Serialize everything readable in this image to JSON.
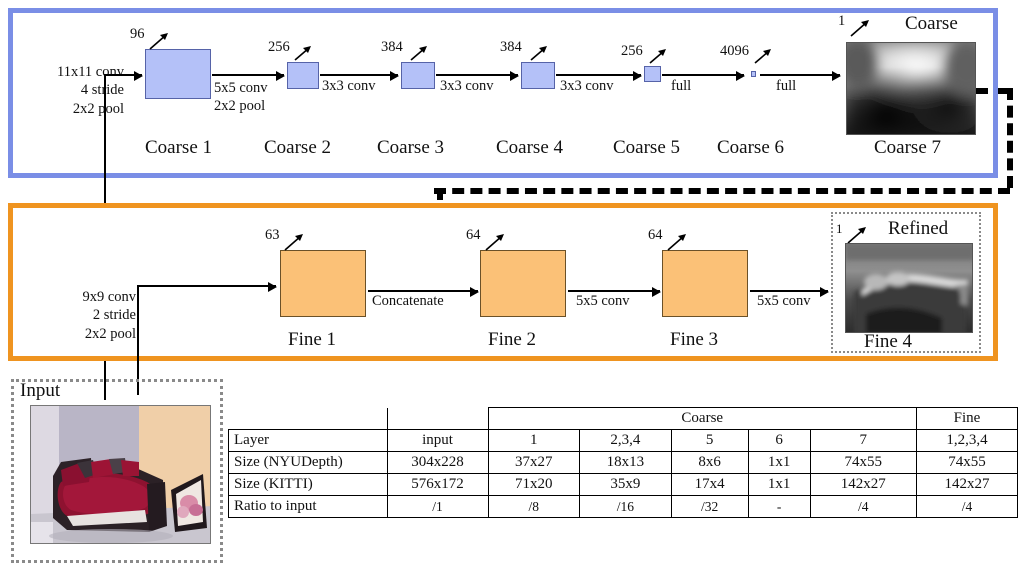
{
  "figure": {
    "type": "neural-network-architecture-diagram",
    "title": "Coarse and Fine depth prediction network"
  },
  "coarse": {
    "section_label": "Coarse",
    "input_op": "11x11 conv\n4 stride\n2x2 pool",
    "input_op_lines": [
      "11x11 conv",
      "4 stride",
      "2x2 pool"
    ],
    "stages": [
      {
        "name": "Coarse 1",
        "channels": "96",
        "next_op_lines": [
          "5x5 conv",
          "2x2 pool"
        ]
      },
      {
        "name": "Coarse 2",
        "channels": "256",
        "next_op_lines": [
          "3x3 conv"
        ]
      },
      {
        "name": "Coarse 3",
        "channels": "384",
        "next_op_lines": [
          "3x3 conv"
        ]
      },
      {
        "name": "Coarse 4",
        "channels": "384",
        "next_op_lines": [
          "3x3 conv"
        ]
      },
      {
        "name": "Coarse 5",
        "channels": "256",
        "next_op_lines": [
          "full"
        ]
      },
      {
        "name": "Coarse 6",
        "channels": "4096",
        "next_op_lines": [
          "full"
        ]
      },
      {
        "name": "Coarse 7",
        "channels": "1",
        "next_op_lines": []
      }
    ],
    "ops": {
      "op1_line1": "5x5 conv",
      "op1_line2": "2x2 pool",
      "op2": "3x3 conv",
      "op3": "3x3 conv",
      "op4": "3x3 conv",
      "op5": "full",
      "op6": "full"
    },
    "output_caption": "Coarse"
  },
  "fine": {
    "section_label": "Fine",
    "input_op_lines": [
      "9x9 conv",
      "2 stride",
      "2x2 pool"
    ],
    "stages": [
      {
        "name": "Fine 1",
        "channels": "63",
        "next_op_lines": [
          "Concatenate"
        ]
      },
      {
        "name": "Fine 2",
        "channels": "64",
        "next_op_lines": [
          "5x5 conv"
        ]
      },
      {
        "name": "Fine 3",
        "channels": "64",
        "next_op_lines": [
          "5x5 conv"
        ]
      },
      {
        "name": "Fine 4",
        "channels": "1",
        "next_op_lines": []
      }
    ],
    "ops": {
      "concat": "Concatenate",
      "op2": "5x5 conv",
      "op3": "5x5 conv"
    },
    "output_caption": "Refined"
  },
  "input_panel": {
    "label": "Input",
    "image_alt": "bedroom photo with red bed"
  },
  "chart_data": {
    "type": "table",
    "title": "Layer sizes",
    "group_headers": [
      {
        "label": "",
        "span": 1
      },
      {
        "label": "",
        "span": 1
      },
      {
        "label": "Coarse",
        "span": 5
      },
      {
        "label": "Fine",
        "span": 1
      }
    ],
    "columns": [
      "Layer",
      "input",
      "1",
      "2,3,4",
      "5",
      "6",
      "7",
      "1,2,3,4"
    ],
    "rows": [
      {
        "label": "Size (NYUDepth)",
        "values": [
          "304x228",
          "37x27",
          "18x13",
          "8x6",
          "1x1",
          "74x55",
          "74x55"
        ]
      },
      {
        "label": "Size (KITTI)",
        "values": [
          "576x172",
          "71x20",
          "35x9",
          "17x4",
          "1x1",
          "142x27",
          "142x27"
        ]
      },
      {
        "label": "Ratio to input",
        "values": [
          "/1",
          "/8",
          "/16",
          "/32",
          "-",
          "/4",
          "/4"
        ]
      }
    ]
  },
  "colors": {
    "coarse_panel_border": "#7a8ee6",
    "coarse_box_fill": "#b4c1f8",
    "fine_panel_border": "#ef9420",
    "fine_box_fill": "#fbc177",
    "arrow": "#000000"
  }
}
